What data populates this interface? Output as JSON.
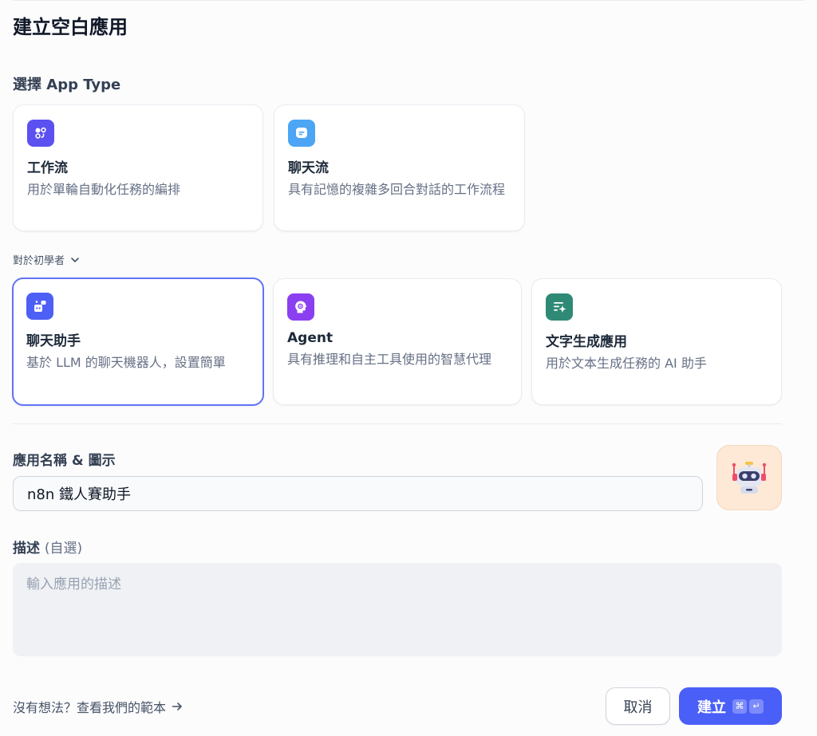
{
  "dialog": {
    "title": "建立空白應用",
    "section_label": "選擇 App Type"
  },
  "app_types": [
    {
      "title": "工作流",
      "desc": "用於單輪自動化任務的編排",
      "icon": "workflow-icon",
      "color": "#5b50f0"
    },
    {
      "title": "聊天流",
      "desc": "具有記憶的複雜多回合對話的工作流程",
      "icon": "chatflow-icon",
      "color": "#4ca5f5"
    }
  ],
  "beginner": {
    "toggle_label": "對於初學者",
    "items": [
      {
        "title": "聊天助手",
        "desc": "基於 LLM 的聊天機器人，設置簡單",
        "icon": "chatbot-icon",
        "color": "#4e5ff5",
        "selected": true
      },
      {
        "title": "Agent",
        "desc": "具有推理和自主工具使用的智慧代理",
        "icon": "agent-icon",
        "color": "#8a3ff0",
        "selected": false
      },
      {
        "title": "文字生成應用",
        "desc": "用於文本生成任務的 AI 助手",
        "icon": "text-generation-icon",
        "color": "#2f8a75",
        "selected": false
      }
    ]
  },
  "name_field": {
    "label": "應用名稱 & 圖示",
    "value": "n8n 鐵人賽助手",
    "avatar_icon": "robot-icon"
  },
  "description_field": {
    "label": "描述",
    "optional": "(自選)",
    "placeholder": "輸入應用的描述"
  },
  "footer": {
    "templates_link": "沒有想法？查看我們的範本",
    "cancel_label": "取消",
    "create_label": "建立",
    "shortcut_keys": [
      "⌘",
      "↵"
    ]
  }
}
